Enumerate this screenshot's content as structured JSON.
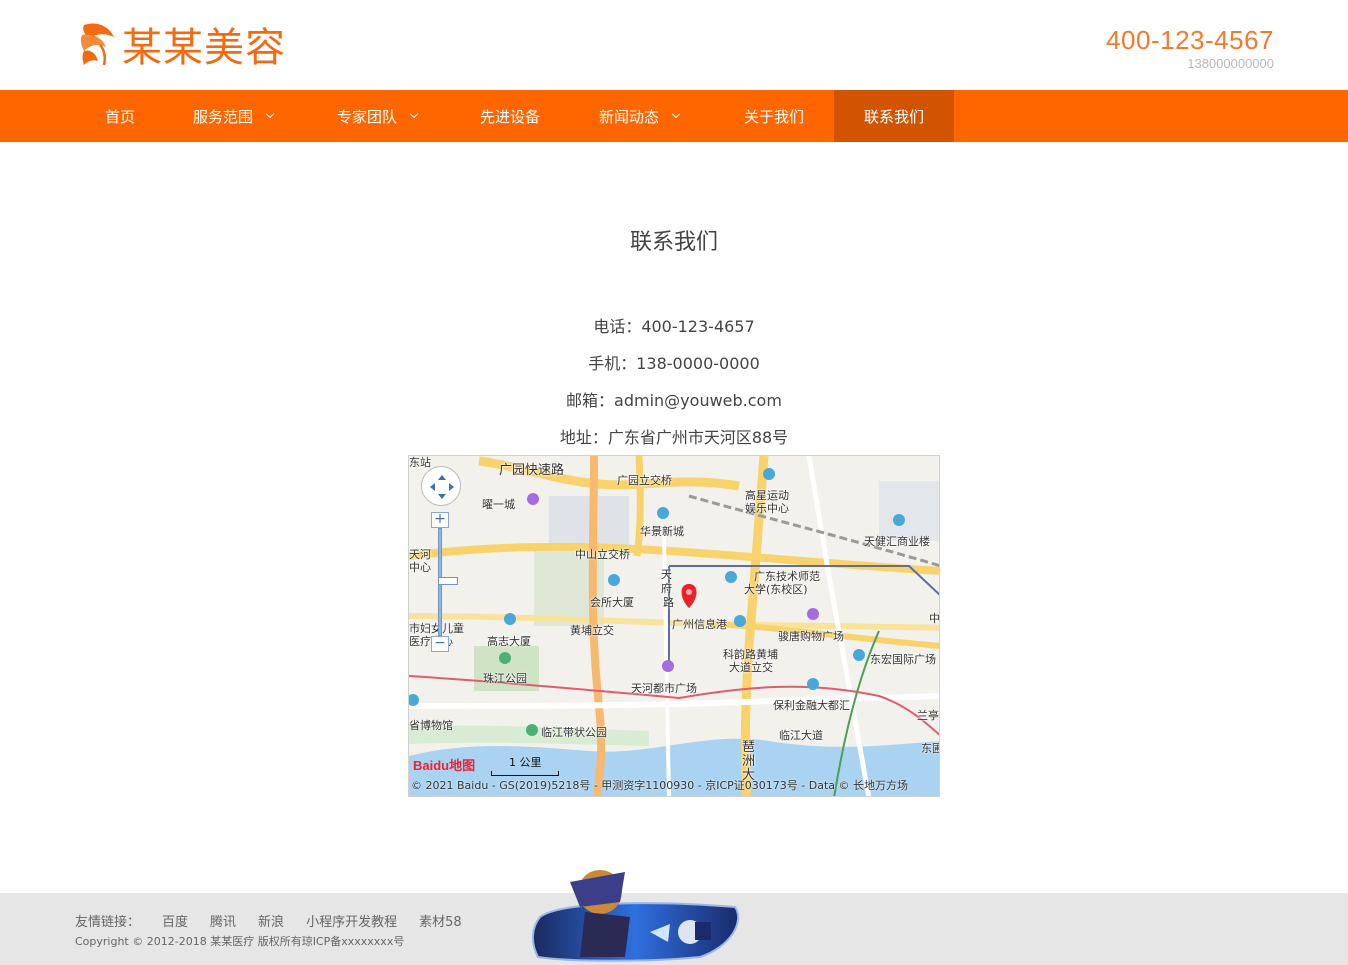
{
  "brand": {
    "name": "某某美容",
    "color": "#f26b12",
    "phone": "400-123-4567",
    "mobile": "138000000000"
  },
  "nav": {
    "bg_color": "#ff6600",
    "active_color": "#d35400",
    "items": [
      {
        "label": "首页",
        "has_dropdown": false
      },
      {
        "label": "服务范围",
        "has_dropdown": true
      },
      {
        "label": "专家团队",
        "has_dropdown": true
      },
      {
        "label": "先进设备",
        "has_dropdown": false
      },
      {
        "label": "新闻动态",
        "has_dropdown": true
      },
      {
        "label": "关于我们",
        "has_dropdown": false
      },
      {
        "label": "联系我们",
        "has_dropdown": false,
        "active": true
      }
    ]
  },
  "main": {
    "title": "联系我们",
    "phone_line": "电话：400-123-4657",
    "mobile_line": "手机：138-0000-0000",
    "email_line": "邮箱：admin@youweb.com",
    "address_line": "地址：广东省广州市天河区88号"
  },
  "map": {
    "labels": {
      "l1": "广园快速路",
      "l2": "广园立交桥",
      "l3": "曜一城",
      "l4": "高星运动",
      "l5": "娱乐中心",
      "l6": "华景新城",
      "l7": "天健汇商业楼",
      "l8": "中山立交桥",
      "l9": "天河",
      "l10": "中心",
      "l11": "天",
      "l12": "府",
      "l13": "路",
      "l14": "广东技术师范",
      "l15": "大学(东校区)",
      "l16": "会所大厦",
      "l17": "黄埔立交",
      "l18": "广州信息港",
      "l19": "骏唐购物广场",
      "l20": "市妇女儿童",
      "l21": "医疗中心",
      "l22": "高志大厦",
      "l23": "科韵路黄埔",
      "l24": "大道立交",
      "l25": "东宏国际广场",
      "l26": "珠江公园",
      "l27": "天河都市广场",
      "l28": "保利金融大都汇",
      "l29": "省博物馆",
      "l30": "临江带状公园",
      "l31": "临江大道",
      "l32": "琶",
      "l33": "洲",
      "l34": "大",
      "l35": "兰亭",
      "l36": "东圃",
      "l37": "中",
      "l38": "东站"
    },
    "scale": "1 公里",
    "baidu": "Baidu地图",
    "copyright": "© 2021 Baidu - GS(2019)5218号 - 甲测资字1100930 - 京ICP证030173号 - Data © 长地万方场"
  },
  "footer": {
    "links_label": "友情链接：",
    "links": [
      "百度",
      "腾讯",
      "新浪",
      "小程序开发教程",
      "素材58"
    ],
    "copyright": "Copyright © 2012-2018 某某医疗 版权所有琼ICP备xxxxxxxx号"
  }
}
